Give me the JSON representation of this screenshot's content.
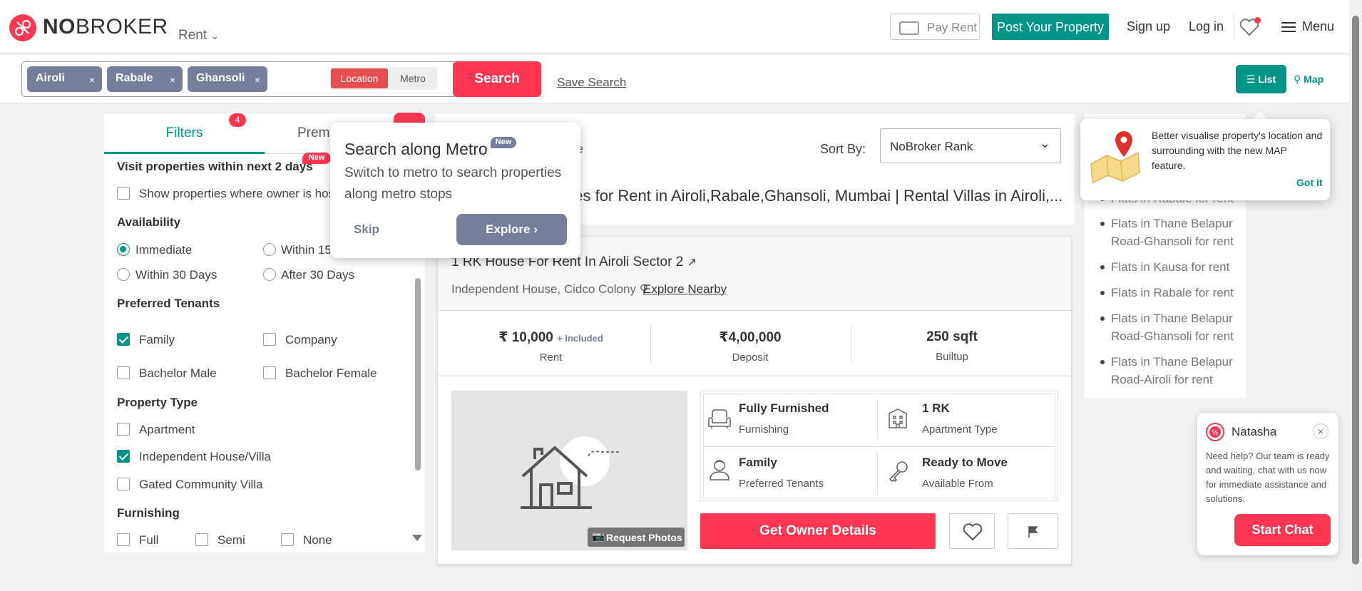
{
  "header": {
    "logo_bold": "NO",
    "logo_rest": "BROKER",
    "rent_dropdown": "Rent",
    "pay_rent": "Pay Rent",
    "post_property": "Post Your Property",
    "sign_up": "Sign up",
    "log_in": "Log in",
    "menu": "Menu"
  },
  "search": {
    "chips": [
      {
        "label": "Airoli"
      },
      {
        "label": "Rabale"
      },
      {
        "label": "Ghansoli"
      }
    ],
    "chip_remove": "×",
    "location_tab": "Location",
    "metro_tab": "Metro",
    "search_button": "Search",
    "save_search": "Save Search",
    "list_view": "List",
    "map_view": "Map"
  },
  "filters": {
    "tab_filters": "Filters",
    "tab_filters_badge": "4",
    "tab_premium": "Premi",
    "visit_heading": "Visit properties within next 2 days",
    "visit_new": "New",
    "show_owner": "Show properties where owner is host",
    "availability_heading": "Availability",
    "availability": [
      "Immediate",
      "Within 15",
      "Within 30 Days",
      "After 30 Days"
    ],
    "availability_selected": "Immediate",
    "tenants_heading": "Preferred Tenants",
    "tenants": [
      "Family",
      "Company",
      "Bachelor Male",
      "Bachelor Female"
    ],
    "tenants_checked": [
      "Family"
    ],
    "property_type_heading": "Property Type",
    "property_types": [
      "Apartment",
      "Independent House/Villa",
      "Gated Community Villa"
    ],
    "property_types_checked": [
      "Independent House/Villa"
    ],
    "furnishing_heading": "Furnishing",
    "furnishing": [
      "Full",
      "Semi",
      "None"
    ]
  },
  "main": {
    "title_prefix": "e",
    "sort_by_label": "Sort By:",
    "sort_value": "NoBroker Rank",
    "page_title": "uses for Rent in Airoli,Rabale,Ghansoli, Mumbai | Rental Villas in Airoli,..."
  },
  "listing": {
    "title": "1 RK House For Rent In Airoli Sector 2",
    "subtitle": "Independent House, Cidco Colony",
    "explore_nearby": "Explore Nearby",
    "rent_value": "₹ 10,000",
    "rent_included": "+ Included",
    "rent_label": "Rent",
    "deposit_value": "₹4,00,000",
    "deposit_label": "Deposit",
    "builtup_value": "250 sqft",
    "builtup_label": "Builtup",
    "request_photos": "Request Photos",
    "attrs": [
      {
        "value": "Fully Furnished",
        "label": "Furnishing",
        "icon": "sofa-icon"
      },
      {
        "value": "1 RK",
        "label": "Apartment Type",
        "icon": "building-icon"
      },
      {
        "value": "Family",
        "label": "Preferred Tenants",
        "icon": "tenant-icon"
      },
      {
        "value": "Ready to Move",
        "label": "Available From",
        "icon": "key-icon"
      }
    ],
    "get_owner_details": "Get Owner Details"
  },
  "right_links": {
    "partial_top": "Flats in Rabale for rent",
    "items": [
      "Flats in Thane Belapur Road-Ghansoli for rent",
      "Flats in Kausa for rent",
      "Flats in Rabale for rent",
      "Flats in Thane Belapur Road-Ghansoli for rent",
      "Flats in Thane Belapur Road-Airoli for rent"
    ]
  },
  "metro_popup": {
    "title": "Search along Metro",
    "new_badge": "New",
    "description": "Switch to metro to search properties along metro stops",
    "skip": "Skip",
    "explore": "Explore"
  },
  "map_popup": {
    "text": "Better visualise property's location and surrounding with the new MAP feature.",
    "got_it": "Got it"
  },
  "chat": {
    "name": "Natasha",
    "message": "Need help? Our team is ready and waiting, chat with us now for immediate assistance and solutions.",
    "start_chat": "Start Chat",
    "close": "×"
  },
  "colors": {
    "brand_red": "#fd3752",
    "teal": "#009587",
    "slate": "#757f9a"
  }
}
